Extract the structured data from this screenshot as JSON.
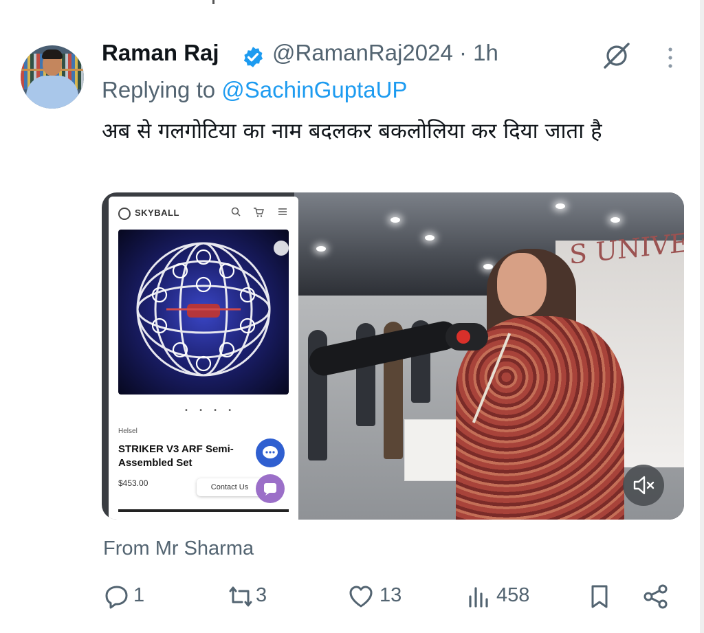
{
  "tweet": {
    "author_name": "Raman Raj",
    "verified": true,
    "handle": "@RamanRaj2024",
    "separator": "·",
    "time": "1h",
    "reply_prefix": "Replying to",
    "reply_to": "@SachinGuptaUP",
    "text": "अब से गलगोटिया का नाम बदलकर बकलोलिया कर दिया जाता है",
    "media_caption": "From Mr Sharma"
  },
  "media": {
    "embedded_store": {
      "brand": "SKYBALL",
      "vendor": "Helsel",
      "product_title": "STRIKER V3 ARF Semi-Assembled Set",
      "price": "$453.00",
      "contact_label": "Contact Us",
      "carousel_dots": "• • • •"
    },
    "booth_sign": "S UNIVE"
  },
  "actions": {
    "replies": "1",
    "reposts": "3",
    "likes": "13",
    "views": "458"
  },
  "icons": {
    "verified": "verified-badge-icon",
    "grok": "grok-icon",
    "more": "more-vertical-icon",
    "mute": "mute-icon",
    "reply": "reply-icon",
    "repost": "repost-icon",
    "like": "heart-icon",
    "views": "views-icon",
    "bookmark": "bookmark-icon",
    "share": "share-icon"
  },
  "colors": {
    "accent": "#1d9bf0",
    "text_primary": "#0f1419",
    "text_secondary": "#536471"
  }
}
